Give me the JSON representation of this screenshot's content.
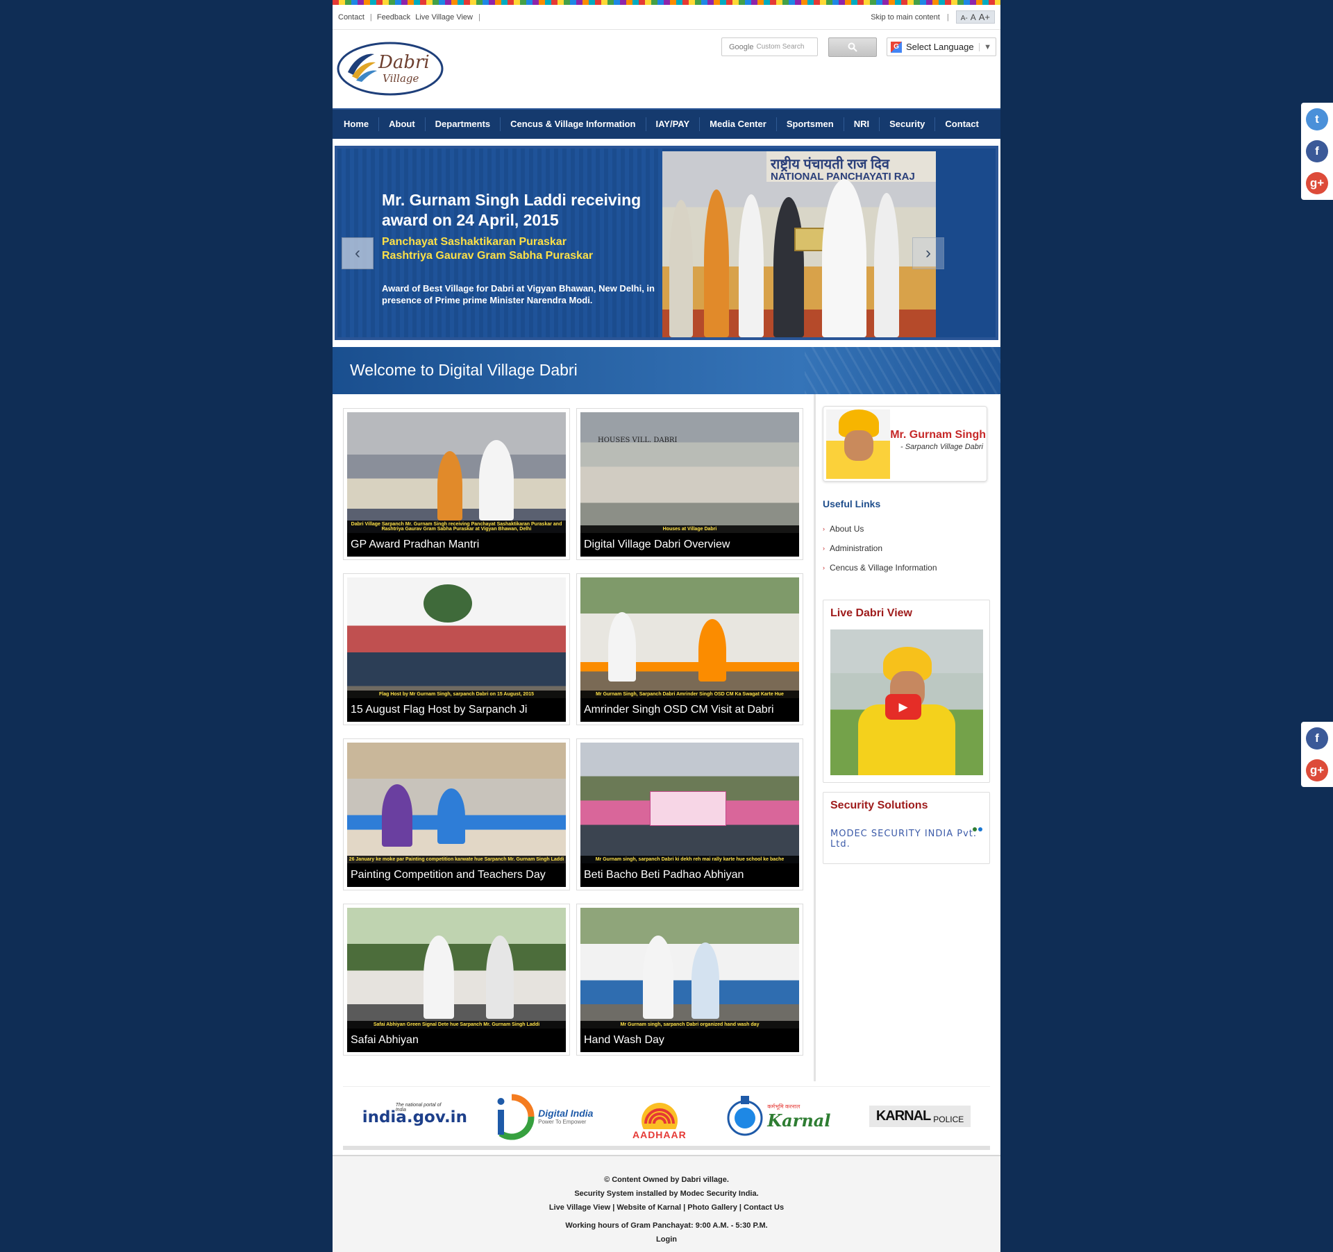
{
  "topbar": {
    "links": [
      "Contact",
      "Feedback",
      "Live Village View"
    ],
    "skip_label": "Skip to main content",
    "font_sizes": [
      "A-",
      "A",
      "A+"
    ]
  },
  "header": {
    "logo_text_main": "Dabri",
    "logo_text_sub": "Village",
    "search_placeholder": "Custom Search",
    "search_brand": "Google",
    "language_label": "Select Language"
  },
  "nav": [
    "Home",
    "About",
    "Departments",
    "Cencus & Village Information",
    "IAY/PAY",
    "Media Center",
    "Sportsmen",
    "NRI",
    "Security",
    "Contact"
  ],
  "slider": {
    "title": "Mr. Gurnam Singh Laddi receiving award on 24 April, 2015",
    "subtitle_line1": "Panchayat Sashaktikaran Puraskar",
    "subtitle_line2": "Rashtriya Gaurav Gram Sabha  Puraskar",
    "description": "Award of Best Village for Dabri at Vigyan Bhawan, New Delhi, in presence of Prime prime Minister Narendra Modi.",
    "banner_text": "राष्ट्रीय पंचायती राज दिव",
    "banner_text2": "NATIONAL PANCHAYATI RAJ"
  },
  "welcome": "Welcome to Digital Village Dabri",
  "gallery": [
    {
      "title": "GP Award Pradhan Mantri",
      "caption": "Dabri Village Sarpanch Mr. Gurnam Singh receiving Panchayat Sashaktikaran Puraskar and Rashtriya Gaurav Gram Sabha Puraskar at Vigyan Bhawan, Delhi"
    },
    {
      "title": "Digital Village Dabri Overview",
      "caption": "Houses at Village Dabri"
    },
    {
      "title": "15 August Flag Host by Sarpanch Ji",
      "caption": "Flag Host by Mr Gurnam Singh, sarpanch Dabri on 15 August, 2015"
    },
    {
      "title": "Amrinder Singh OSD CM Visit at Dabri",
      "caption": "Mr Gurnam Singh, Sarpanch Dabri Amrinder Singh OSD CM Ka Swagat Karte Hue"
    },
    {
      "title": "Painting Competition and Teachers Day",
      "caption": "26 January ke moke par Painting competition karwate hue Sarpanch Mr. Gurnam Singh Laddi"
    },
    {
      "title": "Beti Bacho Beti Padhao Abhiyan",
      "caption": "Mr Gurnam singh, sarpanch Dabri ki dekh reh mai rally karte hue school ke bache"
    },
    {
      "title": "Safai Abhiyan",
      "caption": "Safai Abhiyan Green Signal Dete hue Sarpanch Mr. Gurnam Singh Laddi"
    },
    {
      "title": "Hand Wash Day",
      "caption": "Mr Gurnam singh, sarpanch Dabri organized hand wash day"
    }
  ],
  "overview_overlay": "HOUSES VILL. DABRI",
  "sidebar": {
    "sarpanch_name": "Mr. Gurnam Singh",
    "sarpanch_role": "- Sarpanch Village Dabri",
    "useful_links_heading": "Useful Links",
    "useful_links": [
      "About Us",
      "Administration",
      "Cencus & Village Information"
    ],
    "live_view_heading": "Live Dabri View",
    "security_heading": "Security Solutions",
    "security_logo_text": "MODEC SECURITY INDIA Pvt. Ltd."
  },
  "partners": {
    "india_gov_tag": "The national portal of India",
    "india_gov": "india.gov.in",
    "digital_india": "Digital India",
    "digital_india_tag": "Power To Empower",
    "aadhaar": "AADHAAR",
    "karnal": "Karnal",
    "karnal_hindi": "कर्मभूमि करनाल",
    "karnal_police": "KARNAL",
    "karnal_police_tag": "POLICE"
  },
  "footer": {
    "line1": "© Content Owned by Dabri village.",
    "line2": "Security System installed by Modec Security India.",
    "links": [
      "Live Village View",
      "Website of Karnal",
      "Photo Gallery",
      "Contact Us"
    ],
    "hours": "Working hours of Gram Panchayat: 9:00 A.M. - 5:30 P.M.",
    "login": "Login"
  },
  "colors": {
    "page_bg": "#0f2d55",
    "nav_bg": "#153a6e",
    "accent_red": "#c62828",
    "heading_blue": "#1f4e8c"
  }
}
